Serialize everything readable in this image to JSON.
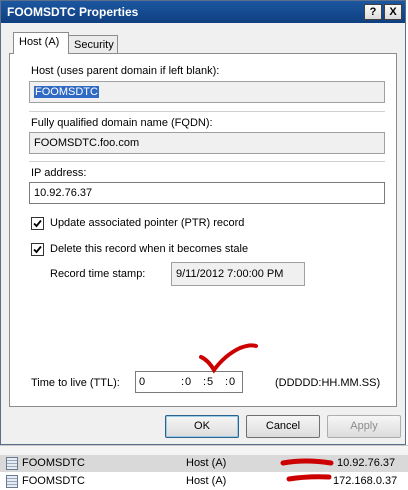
{
  "window": {
    "title": "FOOMSDTC Properties",
    "help_glyph": "?",
    "close_glyph": "X"
  },
  "tabs": [
    {
      "label": "Host (A)",
      "active": true
    },
    {
      "label": "Security",
      "active": false
    }
  ],
  "form": {
    "host_label": "Host (uses parent domain if left blank):",
    "host_value": "FOOMSDTC",
    "fqdn_label": "Fully qualified domain name (FQDN):",
    "fqdn_value": "FOOMSDTC.foo.com",
    "ip_label": "IP address:",
    "ip_value": "10.92.76.37",
    "ptr_label": "Update associated pointer (PTR) record",
    "ptr_checked": true,
    "stale_label": "Delete this record when it becomes stale",
    "stale_checked": true,
    "timestamp_label": "Record time stamp:",
    "timestamp_value": "9/11/2012 7:00:00 PM",
    "ttl_label": "Time to live (TTL):",
    "ttl_days": "0",
    "ttl_hours": "0",
    "ttl_minutes": "5",
    "ttl_seconds": "0",
    "ttl_sep": ":",
    "ttl_format": "(DDDDD:HH.MM.SS)"
  },
  "buttons": {
    "ok": "OK",
    "cancel": "Cancel",
    "apply": "Apply"
  },
  "background_list": [
    {
      "name": "FOOMSDTC",
      "type": "Host (A)",
      "data": "10.92.76.37"
    },
    {
      "name": "FOOMSDTC",
      "type": "Host (A)",
      "data": "172.168.0.37"
    }
  ],
  "colors": {
    "title_bar": "#1c57a0",
    "selection": "#316ac5",
    "annotation_red": "#cc0000"
  },
  "icons": {
    "check": "check-icon",
    "row": "dns-record-icon"
  }
}
